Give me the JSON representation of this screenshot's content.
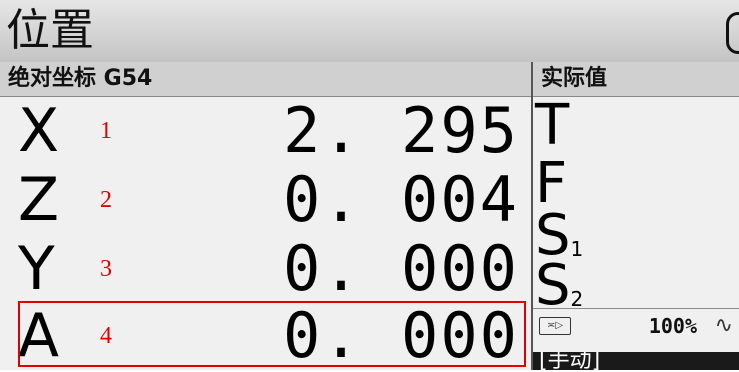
{
  "title": "位置",
  "left_header": "绝对坐标 G54",
  "right_header": "实际值",
  "axes": [
    {
      "axis": "X",
      "index": "1",
      "value": "2. 295"
    },
    {
      "axis": "Z",
      "index": "2",
      "value": "0. 004"
    },
    {
      "axis": "Y",
      "index": "3",
      "value": "0. 000"
    },
    {
      "axis": "A",
      "index": "4",
      "value": "0. 000"
    }
  ],
  "actual": {
    "t": "T",
    "f": "F",
    "s1": "S",
    "s1_sub": "1",
    "s2": "S",
    "s2_sub": "2"
  },
  "feed_override": "100%",
  "mode": "[手动]",
  "colors": {
    "annotation": "#e00000",
    "header_bg": "#d0d0d0",
    "panel_bg": "#f0f0f0"
  }
}
